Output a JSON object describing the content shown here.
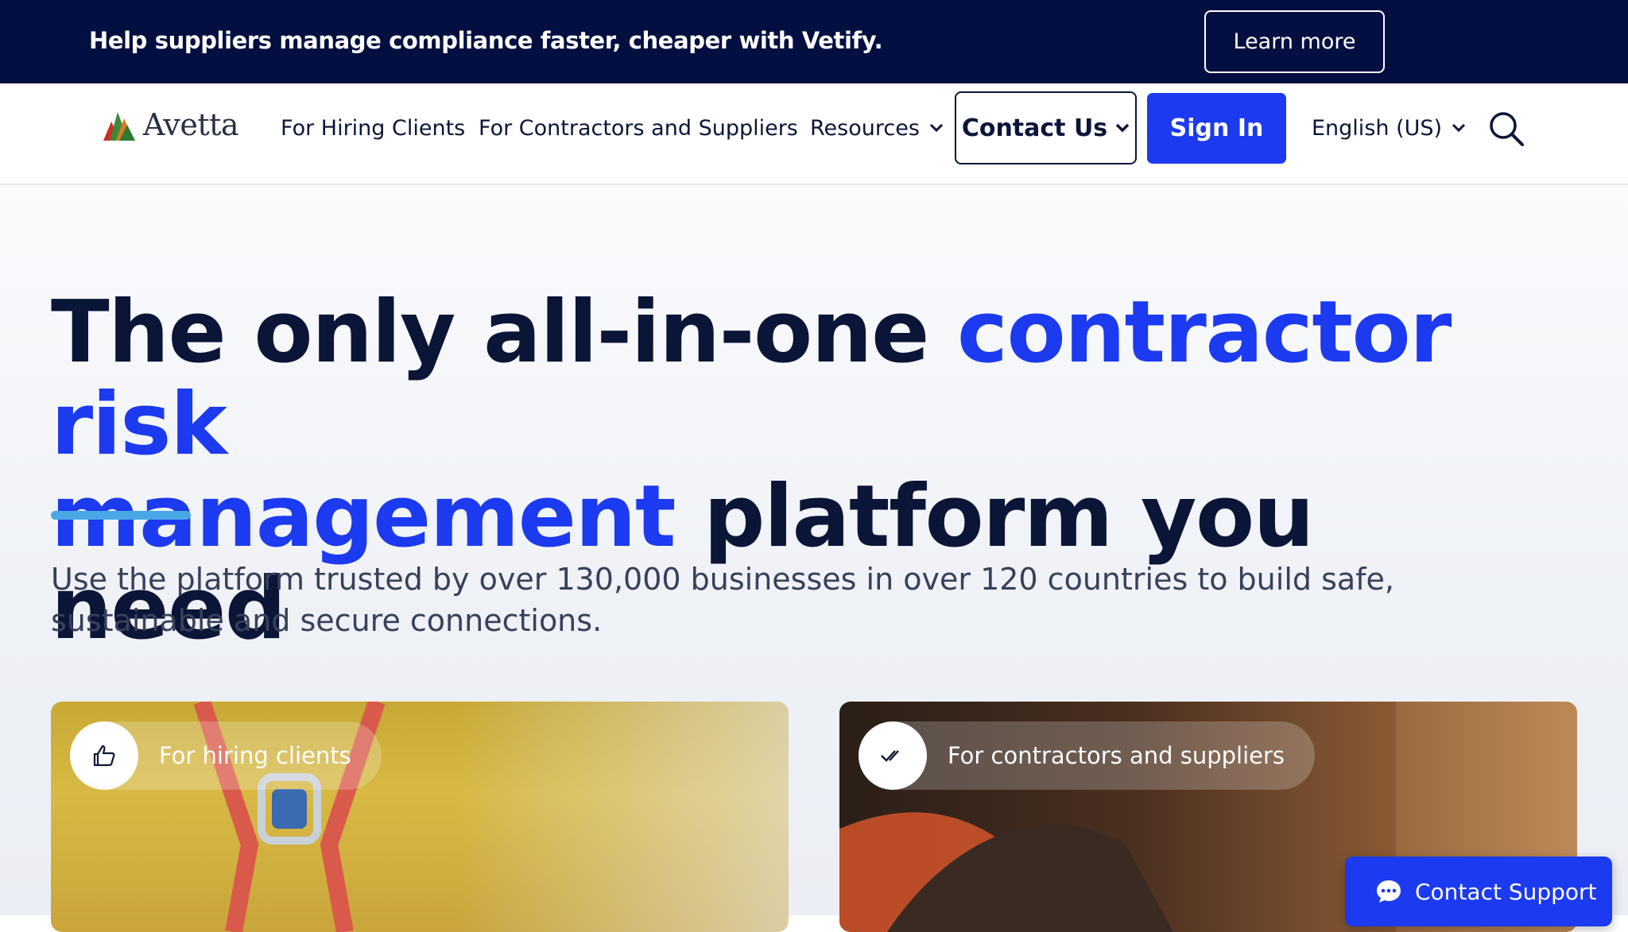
{
  "banner": {
    "text": "Help suppliers manage compliance faster, cheaper with Vetify.",
    "button": "Learn more"
  },
  "nav": {
    "logo_text": "Avetta",
    "logo_colors": [
      "#3a8a3a",
      "#e07a1f",
      "#c9302c"
    ],
    "links": [
      {
        "label": "For Hiring Clients"
      },
      {
        "label": "For Contractors and Suppliers"
      },
      {
        "label": "Resources",
        "icon": "chevron-down-icon"
      }
    ],
    "contact_us": "Contact Us",
    "sign_in": "Sign In",
    "language": "English (US)",
    "search_icon": "search-icon"
  },
  "hero": {
    "headline_part1": "The only all-in-one ",
    "headline_highlight1": "contractor risk",
    "headline_highlight2": "management",
    "headline_part2": " platform you need",
    "subtext": "Use the platform trusted by over 130,000 businesses in over 120 countries to build safe, sustainable and secure connections."
  },
  "cards": [
    {
      "label": "For hiring clients",
      "icon": "thumbs-up-icon"
    },
    {
      "label": "For contractors and suppliers",
      "icon": "double-check-icon"
    }
  ],
  "support": {
    "label": "Contact Support",
    "icon": "chat-icon"
  },
  "colors": {
    "navy": "#030f40",
    "brand_blue": "#1c3af0",
    "accent_bar": "#4aa7e6",
    "text_dark": "#0b1537"
  }
}
